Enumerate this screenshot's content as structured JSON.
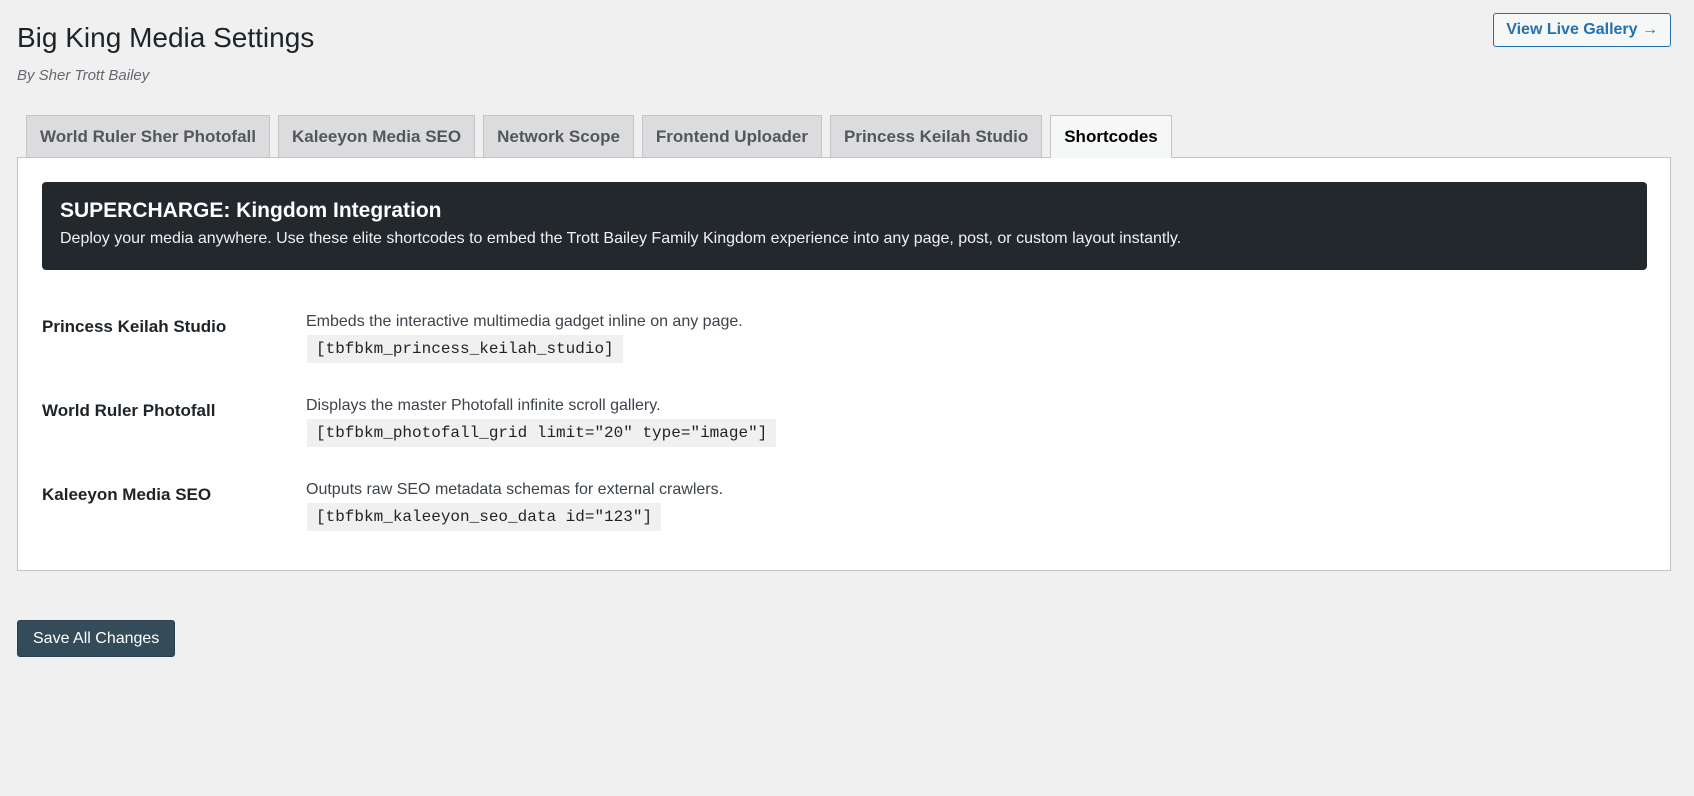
{
  "header": {
    "title": "Big King Media Settings",
    "byline": "By Sher Trott Bailey",
    "live_gallery_label": "View Live Gallery →"
  },
  "tabs": [
    {
      "label": "World Ruler Sher Photofall",
      "active": false
    },
    {
      "label": "Kaleeyon Media SEO",
      "active": false
    },
    {
      "label": "Network Scope",
      "active": false
    },
    {
      "label": "Frontend Uploader",
      "active": false
    },
    {
      "label": "Princess Keilah Studio",
      "active": false
    },
    {
      "label": "Shortcodes",
      "active": true
    }
  ],
  "banner": {
    "title": "SUPERCHARGE: Kingdom Integration",
    "text": "Deploy your media anywhere. Use these elite shortcodes to embed the Trott Bailey Family Kingdom experience into any page, post, or custom layout instantly."
  },
  "shortcodes": [
    {
      "label": "Princess Keilah Studio",
      "description": "Embeds the interactive multimedia gadget inline on any page.",
      "code": "[tbfbkm_princess_keilah_studio]"
    },
    {
      "label": "World Ruler Photofall",
      "description": "Displays the master Photofall infinite scroll gallery.",
      "code": "[tbfbkm_photofall_grid limit=\"20\" type=\"image\"]"
    },
    {
      "label": "Kaleeyon Media SEO",
      "description": "Outputs raw SEO metadata schemas for external crawlers.",
      "code": "[tbfbkm_kaleeyon_seo_data id=\"123\"]"
    }
  ],
  "footer": {
    "save_label": "Save All Changes"
  },
  "colors": {
    "background": "#f0f0f1",
    "accent": "#2271b1",
    "banner_bg": "#23282d",
    "save_bg": "#344b5a"
  }
}
